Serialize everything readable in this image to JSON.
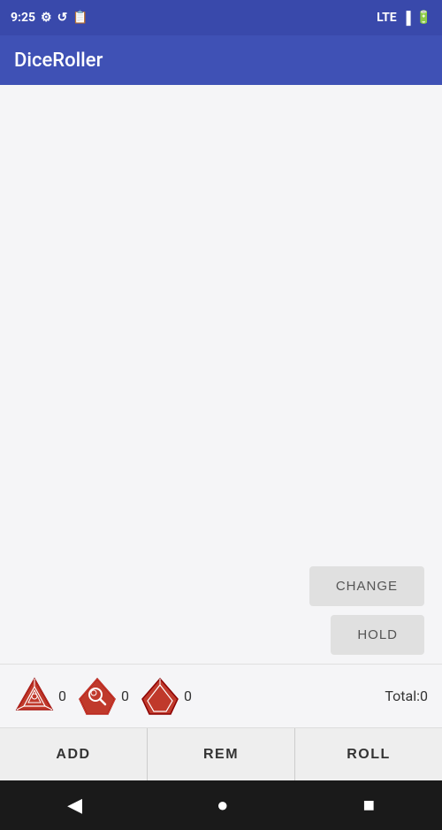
{
  "statusBar": {
    "time": "9:25",
    "lte": "LTE",
    "battery": "⚡"
  },
  "appBar": {
    "title": "DiceRoller"
  },
  "actionButtons": {
    "change_label": "CHANGE",
    "hold_label": "HOLD"
  },
  "diceTray": {
    "dice": [
      {
        "count": "0"
      },
      {
        "count": "0"
      },
      {
        "count": "0"
      }
    ],
    "total_label": "Total:",
    "total_value": "0"
  },
  "bottomBar": {
    "add_label": "ADD",
    "rem_label": "REM",
    "roll_label": "ROLL"
  },
  "navBar": {
    "back_icon": "◀",
    "home_icon": "●",
    "recent_icon": "■"
  }
}
